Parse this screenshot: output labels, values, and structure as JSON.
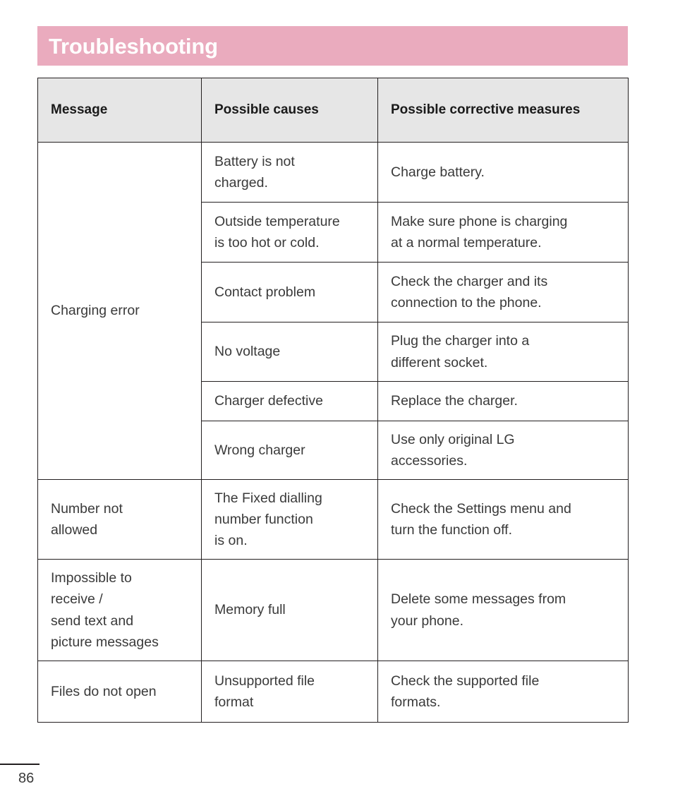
{
  "page": {
    "title": "Troubleshooting",
    "page_number": "86",
    "accent_color": "#eaabbe",
    "header_fill": "#e6e6e6",
    "text_color": "#3a3a3a"
  },
  "table": {
    "columns": [
      "Message",
      "Possible causes",
      "Possible corrective measures"
    ],
    "rows": [
      {
        "message": "Charging error",
        "message_lines": [
          "Charging error"
        ],
        "cause_lines": [
          "Battery is not",
          "charged."
        ],
        "fix_lines": [
          "Charge battery."
        ]
      },
      {
        "message": "",
        "message_lines": [],
        "cause_lines": [
          "Outside temperature",
          "is too hot or cold."
        ],
        "fix_lines": [
          "Make sure phone is charging",
          "at a normal temperature."
        ]
      },
      {
        "message": "",
        "message_lines": [],
        "cause_lines": [
          "Contact problem"
        ],
        "fix_lines": [
          "Check the charger and its",
          "connection to the phone."
        ]
      },
      {
        "message": "",
        "message_lines": [],
        "cause_lines": [
          "No voltage"
        ],
        "fix_lines": [
          "Plug the charger into a",
          "different socket."
        ]
      },
      {
        "message": "",
        "message_lines": [],
        "cause_lines": [
          "Charger defective"
        ],
        "fix_lines": [
          "Replace the charger."
        ]
      },
      {
        "message": "",
        "message_lines": [],
        "cause_lines": [
          "Wrong charger"
        ],
        "fix_lines": [
          "Use only original LG",
          "accessories."
        ]
      },
      {
        "message": "Number not allowed",
        "message_lines": [
          "Number not",
          "allowed"
        ],
        "cause_lines": [
          "The Fixed dialling",
          "number function",
          "is on."
        ],
        "fix_lines": [
          "Check the Settings menu and",
          "turn the function off."
        ]
      },
      {
        "message": "Impossible to receive / send text and picture messages",
        "message_lines": [
          "Impossible to",
          "receive /",
          "send text and",
          "picture messages"
        ],
        "cause_lines": [
          "Memory full"
        ],
        "fix_lines": [
          "Delete some messages from",
          "your phone."
        ]
      },
      {
        "message": "Files do not open",
        "message_lines": [
          "Files do not open"
        ],
        "cause_lines": [
          "Unsupported file",
          "format"
        ],
        "fix_lines": [
          "Check the supported file",
          "formats."
        ]
      }
    ]
  }
}
